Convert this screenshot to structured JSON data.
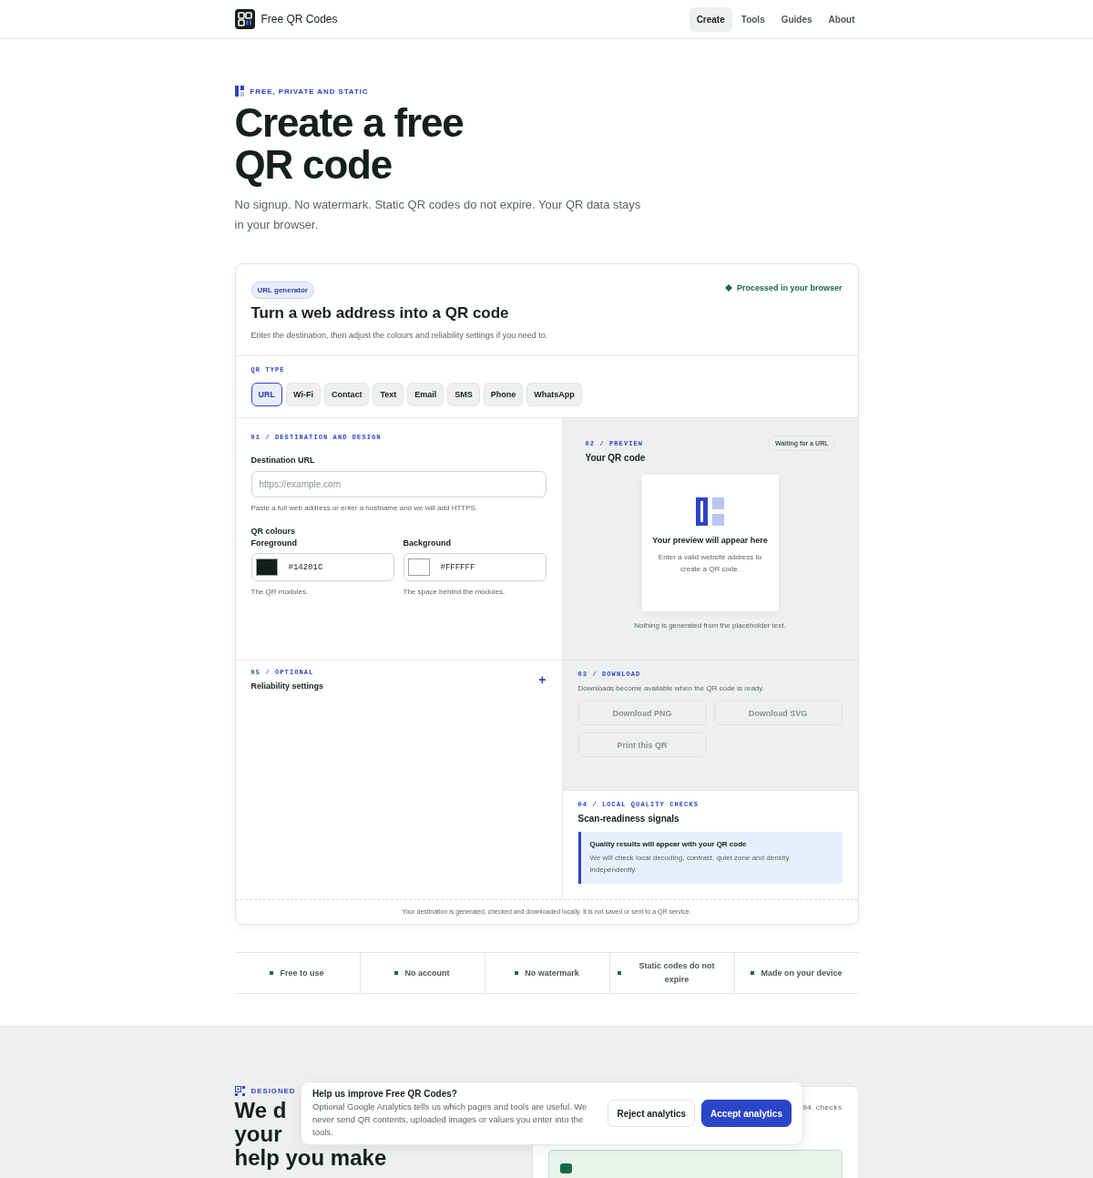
{
  "header": {
    "brand": "Free QR Codes",
    "nav": [
      {
        "label": "Create",
        "selected": true
      },
      {
        "label": "Tools",
        "selected": false
      },
      {
        "label": "Guides",
        "selected": false
      },
      {
        "label": "About",
        "selected": false
      }
    ]
  },
  "hero": {
    "eyebrow": "FREE, PRIVATE AND STATIC",
    "title_lines": [
      "Create a free",
      "QR code"
    ],
    "subtitle": "No signup. No watermark. Static QR codes do not expire. Your QR data stays in your browser."
  },
  "generator": {
    "badge": "URL generator",
    "status": "Processed in your browser",
    "title": "Turn a web address into a QR code",
    "description": "Enter the destination, then adjust the colours and reliability settings if you need to.",
    "qr_type": {
      "label": "QR TYPE",
      "options": [
        {
          "label": "URL",
          "selected": true
        },
        {
          "label": "Wi-Fi",
          "selected": false
        },
        {
          "label": "Contact",
          "selected": false
        },
        {
          "label": "Text",
          "selected": false
        },
        {
          "label": "Email",
          "selected": false
        },
        {
          "label": "SMS",
          "selected": false
        },
        {
          "label": "Phone",
          "selected": false
        },
        {
          "label": "WhatsApp",
          "selected": false
        }
      ]
    },
    "destination": {
      "step": "01 / DESTINATION AND DESIGN",
      "url_label": "Destination URL",
      "url_placeholder": "https://example.com",
      "url_hint": "Paste a full web address or enter a hostname and we will add HTTPS.",
      "colours_label": "QR colours",
      "colours": [
        {
          "label": "Foreground",
          "value": "#14201C",
          "color": "#14201c",
          "hint": "The QR modules."
        },
        {
          "label": "Background",
          "value": "#FFFFFF",
          "color": "#ffffff",
          "hint": "The space behind the modules."
        }
      ]
    },
    "preview": {
      "step": "02 / PREVIEW",
      "title": "Your QR code",
      "status": "Waiting for a URL",
      "placeholder_title": "Your preview will appear here",
      "placeholder_text": "Enter a valid website address to create a QR code.",
      "note": "Nothing is generated from the placeholder text."
    },
    "optional": {
      "step": "05 / OPTIONAL",
      "title": "Reliability settings",
      "toggle": "+"
    },
    "download": {
      "step": "03 / DOWNLOAD",
      "text": "Downloads become available when the QR code is ready.",
      "buttons": [
        {
          "label": "Download PNG",
          "disabled": true
        },
        {
          "label": "Download SVG",
          "disabled": true
        },
        {
          "label": "Print this QR",
          "disabled": true
        }
      ]
    },
    "checks": {
      "step": "04 / LOCAL QUALITY CHECKS",
      "title": "Scan-readiness signals",
      "notice_title": "Quality results will appear with your QR code",
      "notice_text": "We will check local decoding, contrast, quiet zone and density independently."
    },
    "footer": "Your destination is generated, checked and downloaded locally. It is not saved or sent to a QR service."
  },
  "features": [
    "Free to use",
    "No account",
    "No watermark",
    "Static codes do not expire",
    "Made on your device"
  ],
  "next_section": {
    "eyebrow": "DESIGNED",
    "heading_lines": [
      "We d",
      "your",
      "help you make"
    ],
    "card_meta": "04 checks"
  },
  "cookie_banner": {
    "title": "Help us improve Free QR Codes?",
    "text": "Optional Google Analytics tells us which pages and tools are useful. We never send QR contents, uploaded images or values you enter into the tools.",
    "buttons": [
      {
        "label": "Reject analytics",
        "kind": "secondary"
      },
      {
        "label": "Accept analytics",
        "kind": "primary"
      }
    ]
  }
}
